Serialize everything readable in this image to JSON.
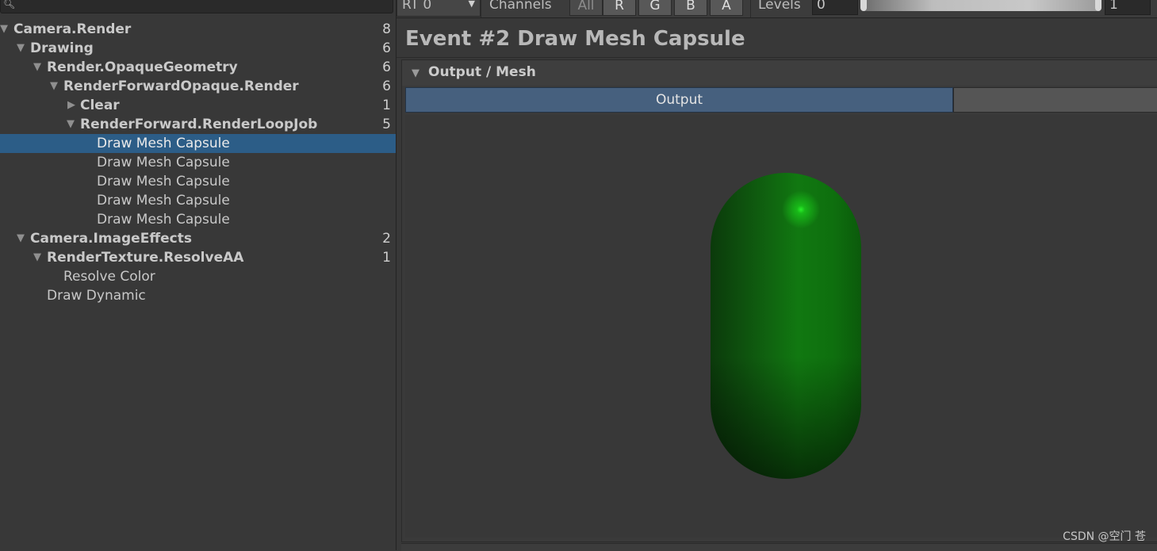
{
  "hierarchy": {
    "rows": [
      {
        "label": "Camera.Render",
        "count": "8",
        "expanded": true
      },
      {
        "label": "Drawing",
        "count": "6",
        "expanded": true
      },
      {
        "label": "Render.OpaqueGeometry",
        "count": "6",
        "expanded": true
      },
      {
        "label": "RenderForwardOpaque.Render",
        "count": "6",
        "expanded": true
      },
      {
        "label": "Clear",
        "count": "1",
        "expanded": false
      },
      {
        "label": "RenderForward.RenderLoopJob",
        "count": "5",
        "expanded": true
      },
      {
        "label": "Draw Mesh Capsule",
        "selected": true
      },
      {
        "label": "Draw Mesh Capsule"
      },
      {
        "label": "Draw Mesh Capsule"
      },
      {
        "label": "Draw Mesh Capsule"
      },
      {
        "label": "Draw Mesh Capsule"
      },
      {
        "label": "Camera.ImageEffects",
        "count": "2",
        "expanded": true
      },
      {
        "label": "RenderTexture.ResolveAA",
        "count": "1",
        "expanded": true
      },
      {
        "label": "Resolve Color"
      },
      {
        "label": "Draw Dynamic"
      }
    ]
  },
  "toolbar": {
    "rt_value": "RT 0",
    "channels_label": "Channels",
    "channels": [
      "All",
      "R",
      "G",
      "B",
      "A"
    ],
    "levels_label": "Levels",
    "levels_min": "0",
    "levels_max": "1"
  },
  "event": {
    "title": "Event #2 Draw Mesh Capsule",
    "group_label": "Output / Mesh",
    "tab_output": "Output"
  },
  "colors": {
    "selection": "#2c5d87",
    "tab_active": "#46607e",
    "capsule_green": "#117811"
  },
  "icons": {
    "search": "magnifier-icon",
    "expanded": "triangle-down-icon",
    "collapsed": "triangle-right-icon",
    "dropdown": "dropdown-arrow-icon"
  },
  "watermark": "CSDN @空门 苍"
}
